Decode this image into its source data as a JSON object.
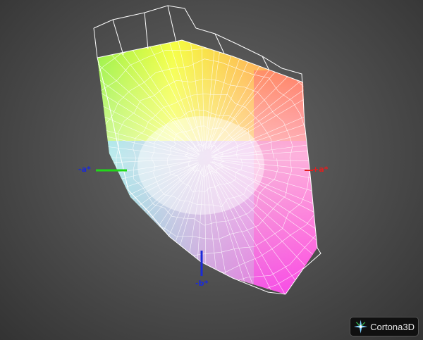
{
  "viewer": {
    "name": "Cortona3D",
    "brand_text": "Cortona3D"
  },
  "axes": {
    "neg_a": "-a*",
    "pos_a": "+a*",
    "neg_b": "-b*"
  },
  "colors": {
    "neg_a_axis": "#22d81a",
    "neg_b_axis": "#1a2ad8",
    "pos_a_axis": "#e02020",
    "wireframe": "#ffffff"
  },
  "icons": {
    "logo": "cortona-star-icon"
  }
}
